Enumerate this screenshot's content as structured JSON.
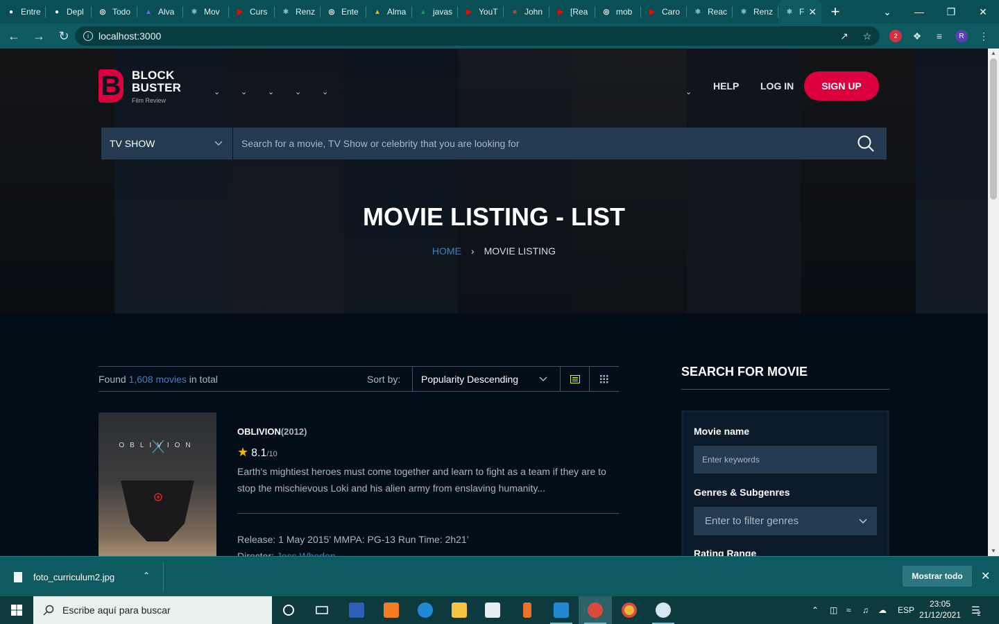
{
  "browser": {
    "tabs": [
      {
        "label": "Entre",
        "icon": "github-icon",
        "color": "#ffffff"
      },
      {
        "label": "Depl",
        "icon": "github-icon",
        "color": "#ffffff"
      },
      {
        "label": "Todo",
        "icon": "globe-icon",
        "color": "#ffffff"
      },
      {
        "label": "Alva",
        "icon": "app-icon",
        "color": "#7b61ff"
      },
      {
        "label": "Mov",
        "icon": "react-icon",
        "color": "#9fd8e8"
      },
      {
        "label": "Curs",
        "icon": "youtube-icon",
        "color": "#ff0000"
      },
      {
        "label": "Renz",
        "icon": "react-icon",
        "color": "#9fd8e8"
      },
      {
        "label": "Ente",
        "icon": "globe-icon",
        "color": "#ffffff"
      },
      {
        "label": "Alma",
        "icon": "drive-icon",
        "color": "#f4b400"
      },
      {
        "label": "javas",
        "icon": "drive-icon",
        "color": "#0f9d58"
      },
      {
        "label": "YouT",
        "icon": "youtube-icon",
        "color": "#ff0000"
      },
      {
        "label": "John",
        "icon": "photo-icon",
        "color": "#8a5a3c"
      },
      {
        "label": "[Rea",
        "icon": "youtube-icon",
        "color": "#ff0000"
      },
      {
        "label": "mob",
        "icon": "globe-icon",
        "color": "#ffffff"
      },
      {
        "label": "Caro",
        "icon": "youtube-icon",
        "color": "#ff0000"
      },
      {
        "label": "Reac",
        "icon": "vite-icon",
        "color": "#9fd8e8"
      },
      {
        "label": "Renz",
        "icon": "react-icon",
        "color": "#9fd8e8"
      }
    ],
    "active_tab": {
      "label": "F",
      "icon": "react-icon"
    },
    "url": "localhost:3000",
    "profile_initial": "R",
    "extension_badge": "2"
  },
  "site": {
    "logo_line1": "BLOCK",
    "logo_line2": "BUSTER",
    "logo_tagline": "Film Review",
    "nav": {
      "help": "HELP",
      "login": "LOG IN",
      "signup": "SIGN UP"
    },
    "search": {
      "category": "TV SHOW",
      "placeholder": "Search for a movie, TV Show or celebrity that you are looking for"
    },
    "hero": {
      "title": "MOVIE LISTING - LIST",
      "breadcrumb_home": "HOME",
      "breadcrumb_current": "MOVIE LISTING"
    }
  },
  "listing": {
    "found_prefix": "Found",
    "found_count": "1,608 movies",
    "found_suffix": "in total",
    "sort_label": "Sort by:",
    "sort_value": "Popularity Descending",
    "movies": [
      {
        "title": "OBLIVION",
        "year": "(2012)",
        "rating": "8.1",
        "rating_of": "/10",
        "description": "Earth's mightiest heroes must come together and learn to fight as a team if they are to stop the mischievous Loki and his alien army from enslaving humanity...",
        "meta": "Release: 1 May 2015’ MMPA: PG-13 Run Time: 2h21’",
        "director_label": "Director:",
        "director": "Joss Whedon",
        "poster_text": "OBLIVION"
      }
    ]
  },
  "sidebar": {
    "title": "SEARCH FOR MOVIE",
    "movie_name_label": "Movie name",
    "movie_name_placeholder": "Enter keywords",
    "genres_label": "Genres & Subgenres",
    "genres_placeholder": "Enter to filter genres",
    "rating_label": "Rating Range"
  },
  "downloads": {
    "file": "foto_curriculum2.jpg",
    "show_all": "Mostrar todo"
  },
  "taskbar": {
    "search_placeholder": "Escribe aquí para buscar",
    "language": "ESP",
    "time": "23:05",
    "date": "21/12/2021",
    "notification_count": "2"
  },
  "colors": {
    "accent": "#dd003f",
    "link": "#4280bf",
    "star": "#f5b50a",
    "chrome": "#0e5a61"
  }
}
